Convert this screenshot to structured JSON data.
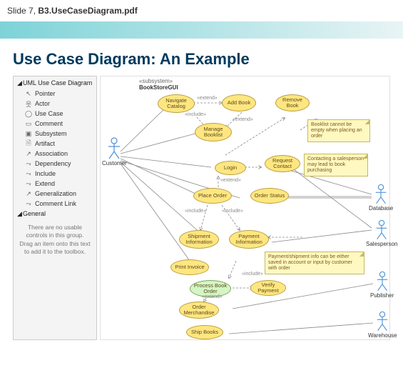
{
  "header": {
    "prefix": "Slide 7, ",
    "filename": "B3.UseCaseDiagram.pdf"
  },
  "slide": {
    "title": "Use Case Diagram: An Example"
  },
  "toolbox": {
    "group1": "UML Use Case Diagram",
    "items": [
      "Pointer",
      "Actor",
      "Use Case",
      "Comment",
      "Subsystem",
      "Artifact",
      "Association",
      "Dependency",
      "Include",
      "Extend",
      "Generalization",
      "Comment Link"
    ],
    "group2": "General",
    "empty_text": "There are no usable controls in this group. Drag an item onto this text to add it to the toolbox."
  },
  "diagram": {
    "subsystem_stereo": "«subsystem»",
    "subsystem_name": "BookStoreGUI",
    "actors": {
      "customer": "Customer",
      "database": "Database",
      "salesperson": "Salesperson",
      "publisher": "Publisher",
      "warehouse": "Warehouse"
    },
    "usecases": {
      "navigate_catalog": "Navigate Catalog",
      "add_book": "Add Book",
      "remove_book": "Remove Book",
      "manage_booklist": "Manage Booklist",
      "request_contact": "Request Contact",
      "login": "Login",
      "place_order": "Place Order",
      "order_status": "Order Status",
      "shipment_info": "Shipment Information",
      "payment_info": "Payment Information",
      "print_invoice": "Print Invoice",
      "process_book_order": "Process Book Order",
      "verify_payment": "Verify Payment",
      "order_merchandise": "Order Merchandise",
      "ship_books": "Ship Books"
    },
    "notes": {
      "booklist_empty": "Booklist cannot be empty when placing an order",
      "contact_sales": "Contacting a salesperson may lead to book purchasing",
      "payment_shipment": "Payment/shipment info can be either saved in account or input by customer with order"
    },
    "labels": {
      "extend": "«extend»",
      "include": "«include»"
    }
  }
}
